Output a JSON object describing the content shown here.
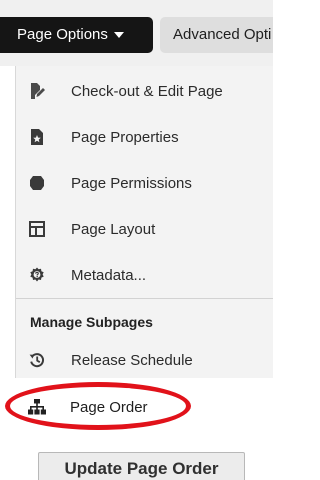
{
  "toolbar": {
    "page_options_label": "Page Options",
    "advanced_options_label": "Advanced Opti"
  },
  "menu": {
    "items": [
      {
        "label": "Check-out & Edit Page",
        "icon": "edit-pencil-icon"
      },
      {
        "label": "Page Properties",
        "icon": "page-properties-icon"
      },
      {
        "label": "Page Permissions",
        "icon": "permissions-badge-icon"
      },
      {
        "label": "Page Layout",
        "icon": "layout-icon"
      },
      {
        "label": "Metadata...",
        "icon": "metadata-icon"
      }
    ],
    "section_header": "Manage Subpages",
    "subpage_items": [
      {
        "label": "Release Schedule",
        "icon": "history-icon"
      },
      {
        "label": "Page Order",
        "icon": "sitemap-icon"
      }
    ]
  },
  "update_button_label": "Update Page Order",
  "colors": {
    "annotation": "#e1121a",
    "toolbar_active": "#151515"
  }
}
